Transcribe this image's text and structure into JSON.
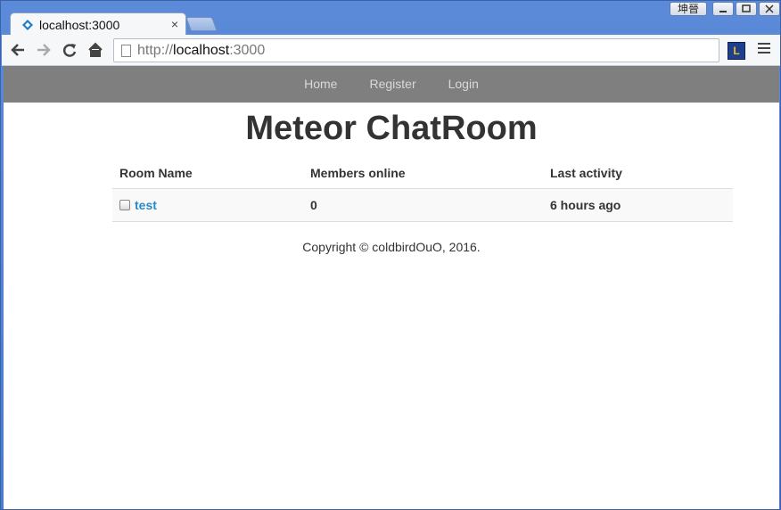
{
  "browser": {
    "user_badge": "坤晉",
    "tab_title": "localhost:3000",
    "tab_close": "×",
    "url": {
      "scheme": "http://",
      "host": "localhost",
      "port": ":3000"
    },
    "extension_label": "L"
  },
  "navbar": {
    "items": [
      {
        "label": "Home"
      },
      {
        "label": "Register"
      },
      {
        "label": "Login"
      }
    ]
  },
  "main": {
    "title": "Meteor ChatRoom",
    "table": {
      "headers": [
        "Room Name",
        "Members online",
        "Last activity"
      ],
      "rows": [
        {
          "name": "test",
          "members": "0",
          "last_activity": "6 hours ago"
        }
      ]
    },
    "footer": "Copyright © coldbirdOuO, 2016."
  },
  "colors": {
    "accent_link": "#2a8ac7",
    "navbar_bg": "#7f7f7f"
  }
}
